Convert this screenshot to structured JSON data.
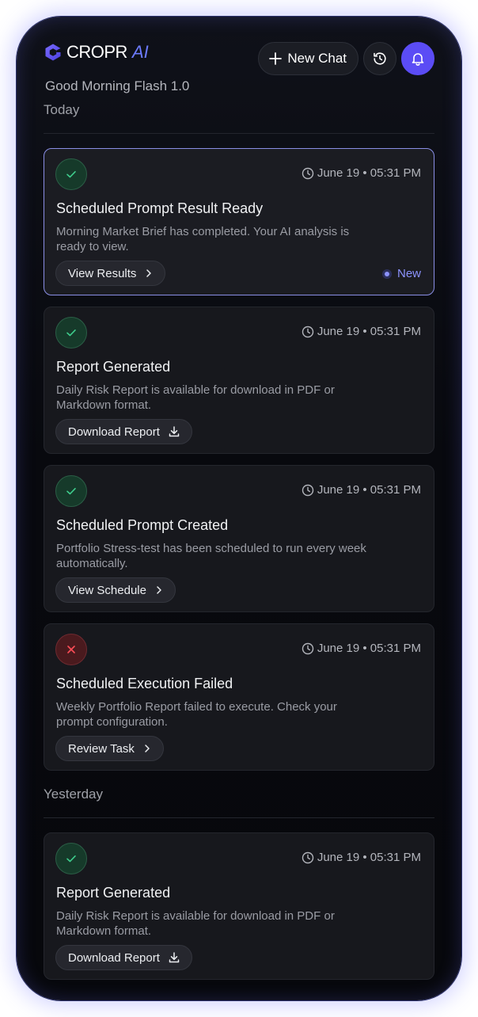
{
  "app": {
    "brand": "CROPR",
    "brand_ai": "AI",
    "subtitle": "Good Morning Flash 1.0"
  },
  "header": {
    "new_chat_label": "New Chat",
    "history_icon": "history-icon",
    "bell_icon": "bell-icon",
    "accent_color": "#5b4cf5"
  },
  "sections": {
    "today": "Today",
    "yesterday": "Yesterday"
  },
  "notifications": [
    {
      "status": "success",
      "time": "June 19 • 05:31 PM",
      "title": "Scheduled Prompt Result Ready",
      "description": "Morning Market Brief has completed. Your AI analysis is ready to view.",
      "action": "View Results",
      "action_icon": "chevron-right-icon",
      "badge": "New"
    },
    {
      "status": "success",
      "time": "June 19 • 05:31 PM",
      "title": "Report Generated",
      "description": "Daily Risk Report is available for download in PDF or Markdown format.",
      "action": "Download Report",
      "action_icon": "download-icon"
    },
    {
      "status": "success",
      "time": "June 19 • 05:31 PM",
      "title": "Scheduled Prompt Created",
      "description": "Portfolio Stress-test has been scheduled to run every week automatically.",
      "action": "View Schedule",
      "action_icon": "chevron-right-icon"
    },
    {
      "status": "error",
      "time": "June 19 • 05:31 PM",
      "title": "Scheduled Execution Failed",
      "description": "Weekly Portfolio Report failed to execute. Check your prompt configuration.",
      "action": "Review Task",
      "action_icon": "chevron-right-icon"
    },
    {
      "status": "success",
      "time": "June 19 • 05:31 PM",
      "title": "Report Generated",
      "description": "Daily Risk Report is available for download in PDF or Markdown format.",
      "action": "Download Report",
      "action_icon": "download-icon"
    }
  ]
}
